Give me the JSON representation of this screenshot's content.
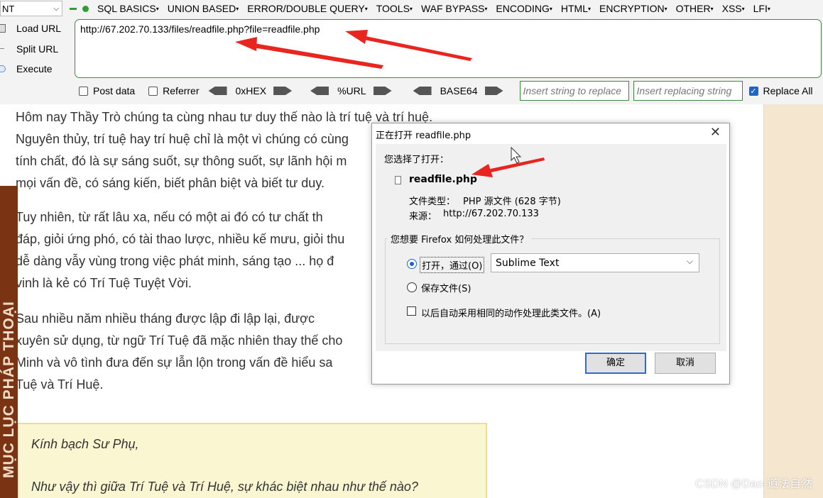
{
  "hackbar": {
    "int_select": "NT",
    "menus": [
      "SQL BASICS",
      "UNION BASED",
      "ERROR/DOUBLE QUERY",
      "TOOLS",
      "WAF BYPASS",
      "ENCODING",
      "HTML",
      "ENCRYPTION",
      "OTHER",
      "XSS",
      "LFI"
    ],
    "load_url": "Load URL",
    "split_url": "Split URL",
    "execute": "Execute",
    "url": "http://67.202.70.133/files/readfile.php?file=readfile.php",
    "post_data": "Post data",
    "referrer": "Referrer",
    "hex": "0xHEX",
    "urlenc": "%URL",
    "base64": "BASE64",
    "insert_replace_ph": "Insert string to replace",
    "insert_replacing_ph": "Insert replacing string",
    "replace_all": "Replace All",
    "replace_all_checked": true
  },
  "article": {
    "p1": [
      "Hôm nay Thầy Trò chúng ta cùng nhau tư duy thế nào là trí tuệ và trí huệ.",
      "Nguyên thủy, trí tuệ hay trí huệ chỉ là một vì chúng có cùng",
      "tính chất, đó là sự sáng suốt, sự thông suốt, sự lãnh hội m",
      "mọi vấn đề, có sáng kiến, biết phân biệt và biết tư duy."
    ],
    "p2": [
      "Tuy nhiên, từ rất lâu xa, nếu có một ai đó có tư chất th",
      "đáp, giỏi ứng phó, có tài thao lược, nhiều kế mưu, giỏi thu",
      "dễ dàng vẫy vùng trong việc phát minh, sáng tạo ... họ đ",
      "vinh là kẻ có Trí Tuệ Tuyệt Vời."
    ],
    "p3": [
      "Sau nhiều năm nhiều tháng được lập đi lập lại, được",
      "xuyên sử dụng, từ ngữ Trí Tuệ đã mặc nhiên thay thế cho",
      "Minh và vô tình đưa đến sự lẫn lộn trong vấn đề hiểu sa",
      "Tuệ và Trí Huệ."
    ],
    "quote1": "Kính bạch Sư Phụ,",
    "quote2": "Như vậy thì giữa Trí Tuệ và Trí Huệ, sự khác biệt nhau như thế nào?",
    "side_tab": "MỤC LỤC PHÁP THOẠI"
  },
  "dialog": {
    "title": "正在打开 readfile.php",
    "close": "✕",
    "chosen_label": "您选择了打开：",
    "filename": "readfile.php",
    "filetype_label": "文件类型：",
    "filetype_value": "PHP 源文件 (628 字节)",
    "source_label": "来源：",
    "source_value": "http://67.202.70.133",
    "question": "您想要 Firefox 如何处理此文件？",
    "open_with": "打开，通过(O)",
    "app": "Sublime Text",
    "save_file": "保存文件(S)",
    "auto_label": "以后自动采用相同的动作处理此类文件。(A)",
    "ok": "确定",
    "cancel": "取消"
  },
  "watermark": "CSDN @Dao-道法自然",
  "colors": {
    "accent": "#1e66c5",
    "hackbar_green": "#3c8b3c",
    "arrow_red": "#e8261f",
    "sidebar_brown": "#7a3413"
  }
}
